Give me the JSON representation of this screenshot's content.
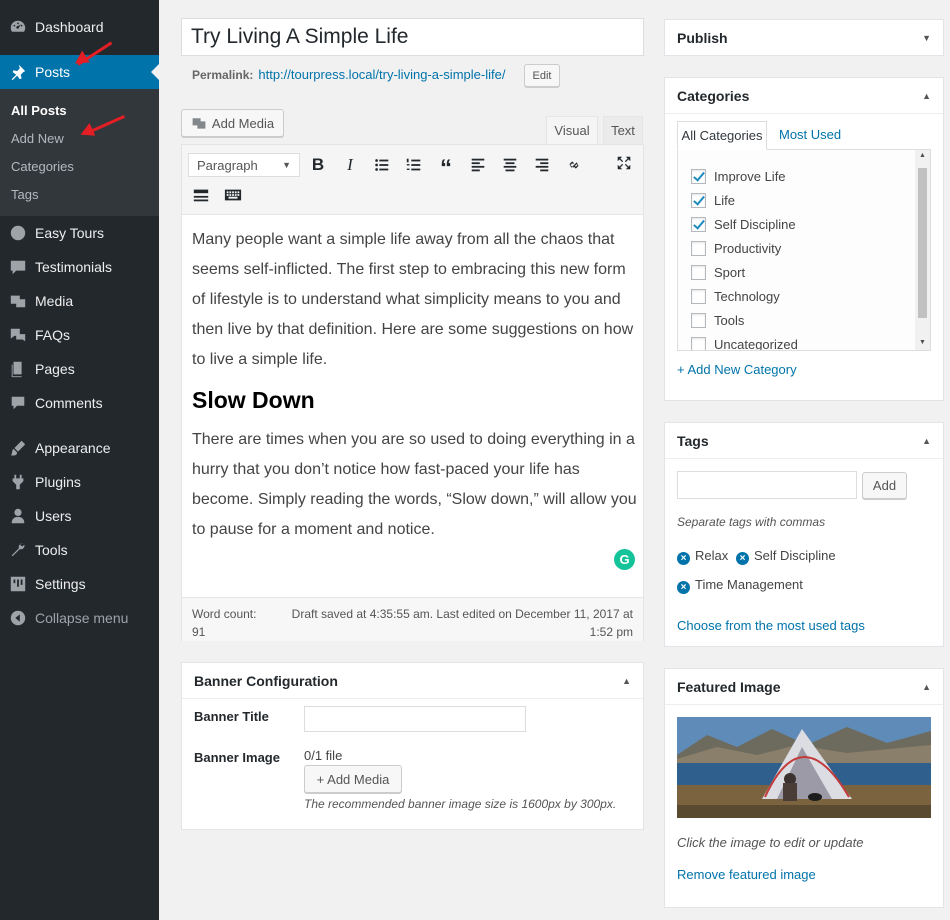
{
  "menu": {
    "dashboard": "Dashboard",
    "posts": "Posts",
    "submenu": [
      "All Posts",
      "Add New",
      "Categories",
      "Tags"
    ],
    "items": [
      "Easy Tours",
      "Testimonials",
      "Media",
      "FAQs",
      "Pages",
      "Comments",
      "Appearance",
      "Plugins",
      "Users",
      "Tools",
      "Settings"
    ],
    "collapse": "Collapse menu"
  },
  "post": {
    "title": "Try Living A Simple Life",
    "permalink_label": "Permalink:",
    "permalink_url": "http://tourpress.local/try-living-a-simple-life/",
    "edit_label": "Edit",
    "add_media": "Add Media",
    "tab_visual": "Visual",
    "tab_text": "Text",
    "format_select": "Paragraph",
    "paragraph1": "Many people want a simple life away from all the chaos that seems self-inflicted. The first step to embracing this new form of lifestyle is to understand what simplicity means to you and then live by that definition. Here are some suggestions on how to live a simple life.",
    "heading": "Slow Down",
    "paragraph2": "There are times when you are so used to doing everything in a hurry that you don’t notice how fast-paced your life has become. Simply reading the words, “Slow down,” will allow you to pause for a moment and notice.",
    "word_count_label": "Word count:",
    "word_count": "91",
    "status_line1": "Draft saved at 4:35:55 am. Last edited on December 11, 2017 at",
    "status_line2": "1:52 pm"
  },
  "banner": {
    "title": "Banner Configuration",
    "banner_title_label": "Banner Title",
    "banner_title_value": "",
    "banner_image_label": "Banner Image",
    "file_count": "0/1 file",
    "add_media": "+ Add Media",
    "hint": "The recommended banner image size is 1600px by 300px."
  },
  "publish": {
    "title": "Publish"
  },
  "categories": {
    "title": "Categories",
    "tab_all": "All Categories",
    "tab_most": "Most Used",
    "items": [
      {
        "label": "Improve Life",
        "checked": true
      },
      {
        "label": "Life",
        "checked": true
      },
      {
        "label": "Self Discipline",
        "checked": true
      },
      {
        "label": "Productivity",
        "checked": false
      },
      {
        "label": "Sport",
        "checked": false
      },
      {
        "label": "Technology",
        "checked": false
      },
      {
        "label": "Tools",
        "checked": false
      },
      {
        "label": "Uncategorized",
        "checked": false
      }
    ],
    "add_new": "+ Add New Category"
  },
  "tags": {
    "title": "Tags",
    "input_value": "",
    "add_label": "Add",
    "hint": "Separate tags with commas",
    "items": [
      "Relax",
      "Self Discipline",
      "Time Management"
    ],
    "choose": "Choose from the most used tags"
  },
  "featured": {
    "title": "Featured Image",
    "hint": "Click the image to edit or update",
    "remove": "Remove featured image"
  },
  "colors": {
    "sidebar": "#23282d",
    "accent": "#0073aa",
    "arrow": "#e31e24"
  }
}
